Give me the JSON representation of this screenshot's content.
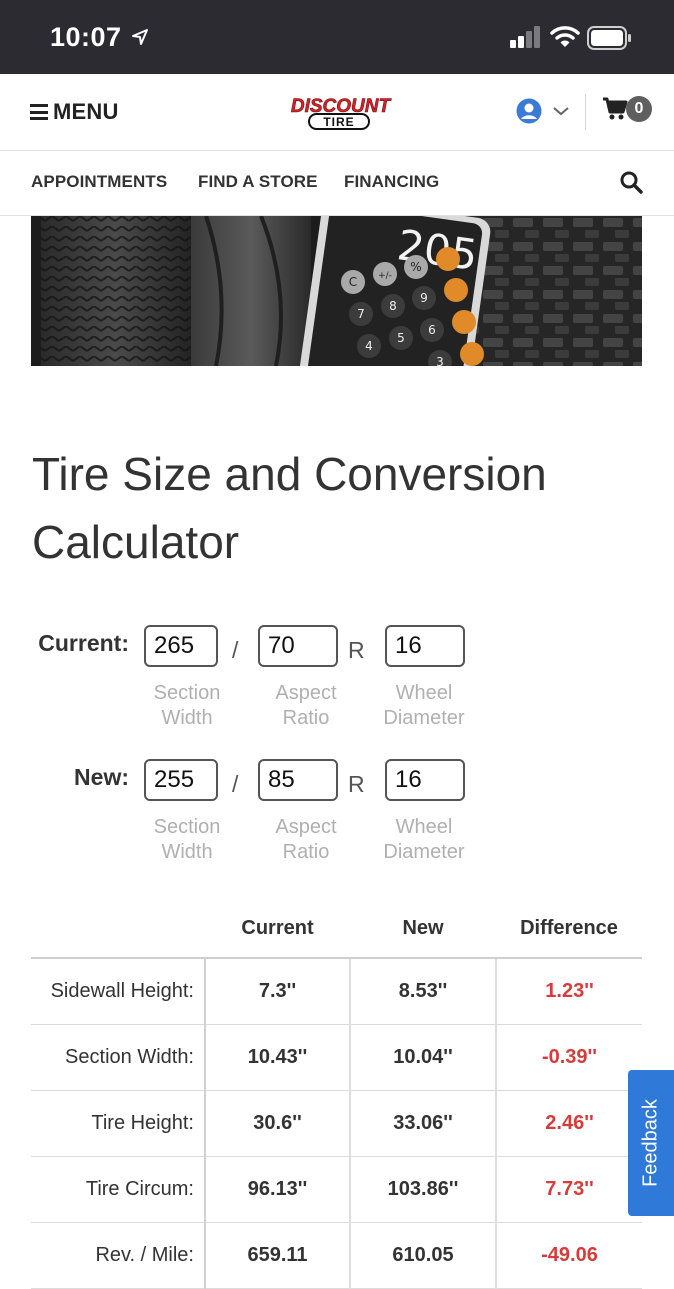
{
  "status_bar": {
    "time": "10:07"
  },
  "header": {
    "menu_label": "MENU",
    "logo_line1": "DISCOUNT",
    "logo_line2": "TIRE",
    "cart_count": "0"
  },
  "nav": {
    "items": [
      "APPOINTMENTS",
      "FIND A STORE",
      "FINANCING"
    ]
  },
  "hero": {
    "calc_display": "205",
    "keys": [
      "C",
      "+/-",
      "%",
      "7",
      "8",
      "9",
      "4",
      "5",
      "6",
      "3"
    ]
  },
  "page_title": "Tire Size and Conversion Calculator",
  "calculator": {
    "current_label": "Current:",
    "new_label": "New:",
    "current": {
      "section_width": "265",
      "aspect_ratio": "70",
      "wheel_diameter": "16"
    },
    "new": {
      "section_width": "255",
      "aspect_ratio": "85",
      "wheel_diameter": "16"
    },
    "slash": "/",
    "r": "R",
    "help": {
      "section_width": [
        "Section",
        "Width"
      ],
      "aspect_ratio": [
        "Aspect",
        "Ratio"
      ],
      "wheel_diameter": [
        "Wheel",
        "Diameter"
      ]
    }
  },
  "results": {
    "headers": [
      "Current",
      "New",
      "Difference"
    ],
    "rows": [
      {
        "label": "Sidewall Height:",
        "current": "7.3''",
        "new": "8.53''",
        "difference": "1.23''"
      },
      {
        "label": "Section Width:",
        "current": "10.43''",
        "new": "10.04''",
        "difference": "-0.39''"
      },
      {
        "label": "Tire Height:",
        "current": "30.6''",
        "new": "33.06''",
        "difference": "2.46''"
      },
      {
        "label": "Tire Circum:",
        "current": "96.13''",
        "new": "103.86''",
        "difference": "7.73''"
      },
      {
        "label": "Rev. / Mile:",
        "current": "659.11",
        "new": "610.05",
        "difference": "-49.06"
      }
    ]
  },
  "feedback_label": "Feedback",
  "colors": {
    "status_bar": "#2b2b31",
    "logo_red": "#d1232a",
    "difference_red": "#d73c3c",
    "feedback_blue": "#2f7ad8",
    "user_blue": "#3d7ad6"
  }
}
